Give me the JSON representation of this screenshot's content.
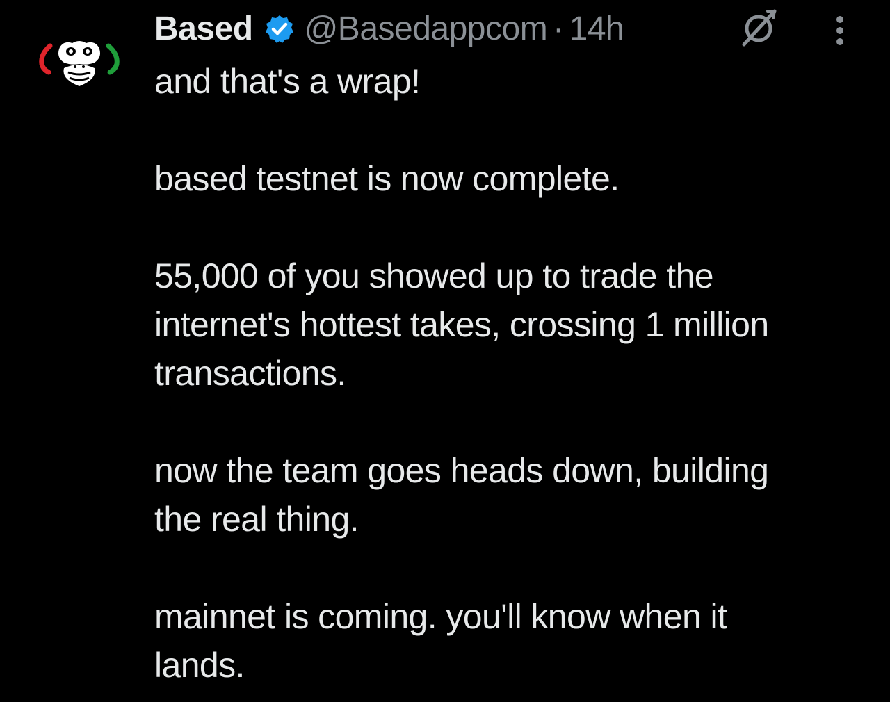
{
  "post": {
    "author": {
      "display_name": "Based",
      "handle": "@Basedappcom",
      "verified": true,
      "avatar_icon": "monkey-avatar-icon"
    },
    "separator": "·",
    "time": "14h",
    "actions": {
      "grok_icon": "grok-icon",
      "more_icon": "more-vertical-icon"
    },
    "paragraphs": [
      "and that's a wrap!",
      "based testnet is now complete.",
      "55,000 of you showed up to trade the\ninternet's hottest takes, crossing 1 million\ntransactions.",
      "now the team goes heads down, building\nthe real thing.",
      "mainnet is coming. you'll know when it\nlands."
    ]
  },
  "colors": {
    "background": "#000000",
    "text_primary": "#e7e9ea",
    "text_secondary": "#8b9096",
    "verified_badge": "#1d9bf0",
    "avatar_red": "#e0242b",
    "avatar_green": "#1f9e3a"
  }
}
